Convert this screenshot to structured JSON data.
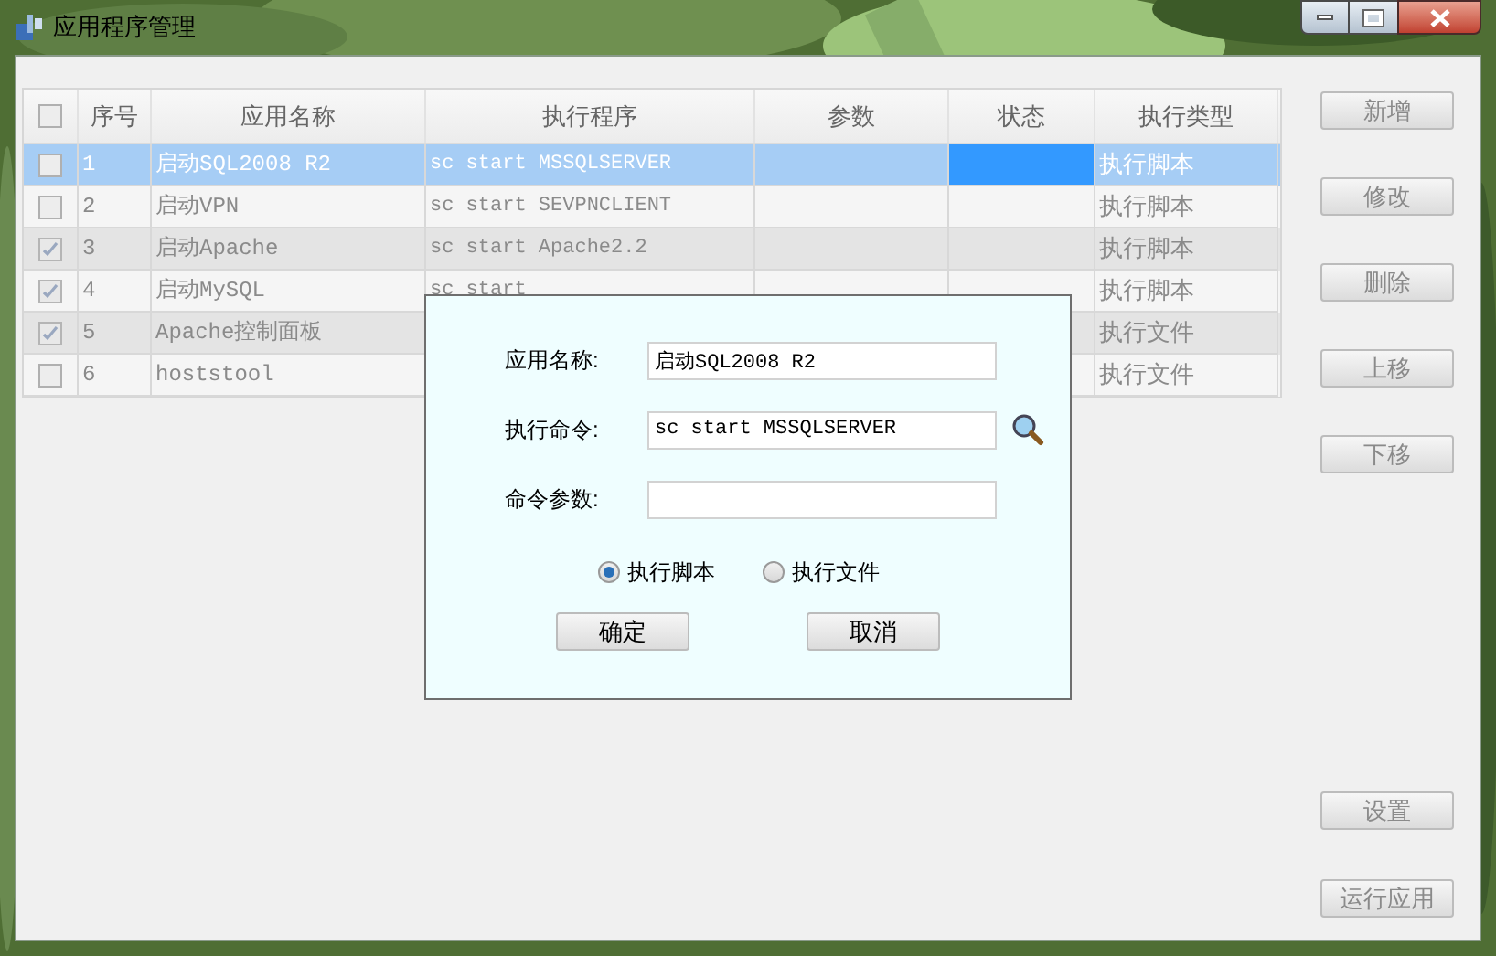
{
  "window": {
    "title": "应用程序管理"
  },
  "table": {
    "header_checkbox": {
      "checked": false
    },
    "columns": [
      "序号",
      "应用名称",
      "执行程序",
      "参数",
      "状态",
      "执行类型"
    ],
    "rows": [
      {
        "selected": true,
        "checked": false,
        "number": "1",
        "name": "启动SQL2008 R2",
        "command": "sc start MSSQLSERVER",
        "type": "执行脚本"
      },
      {
        "selected": false,
        "checked": false,
        "number": "2",
        "name": "启动VPN",
        "command": "sc start SEVPNCLIENT",
        "type": "执行脚本"
      },
      {
        "selected": false,
        "checked": true,
        "number": "3",
        "name": "启动Apache",
        "command": "sc start Apache2.2",
        "type": "执行脚本"
      },
      {
        "selected": false,
        "checked": true,
        "number": "4",
        "name": "启动MySQL",
        "command": "sc start",
        "type": "执行脚本"
      },
      {
        "selected": false,
        "checked": true,
        "number": "5",
        "name": "Apache控制面板",
        "type": "执行文件"
      },
      {
        "selected": false,
        "checked": false,
        "number": "6",
        "name": "hoststool",
        "type": "执行文件"
      }
    ]
  },
  "side_buttons": [
    "新增",
    "修改",
    "删除",
    "上移",
    "下移"
  ],
  "bottom_buttons": [
    "设置",
    "运行应用"
  ],
  "dialog": {
    "fields": [
      {
        "kind": "text",
        "label": "应用名称:",
        "value": "启动SQL2008 R2"
      },
      {
        "kind": "browse",
        "label": "执行命令:",
        "value": "sc start MSSQLSERVER"
      },
      {
        "kind": "text",
        "label": "命令参数:"
      }
    ],
    "radios": [
      {
        "label": "执行脚本",
        "selected": true
      },
      {
        "label": "执行文件",
        "selected": false
      }
    ],
    "buttons": [
      "确定",
      "取消"
    ]
  }
}
